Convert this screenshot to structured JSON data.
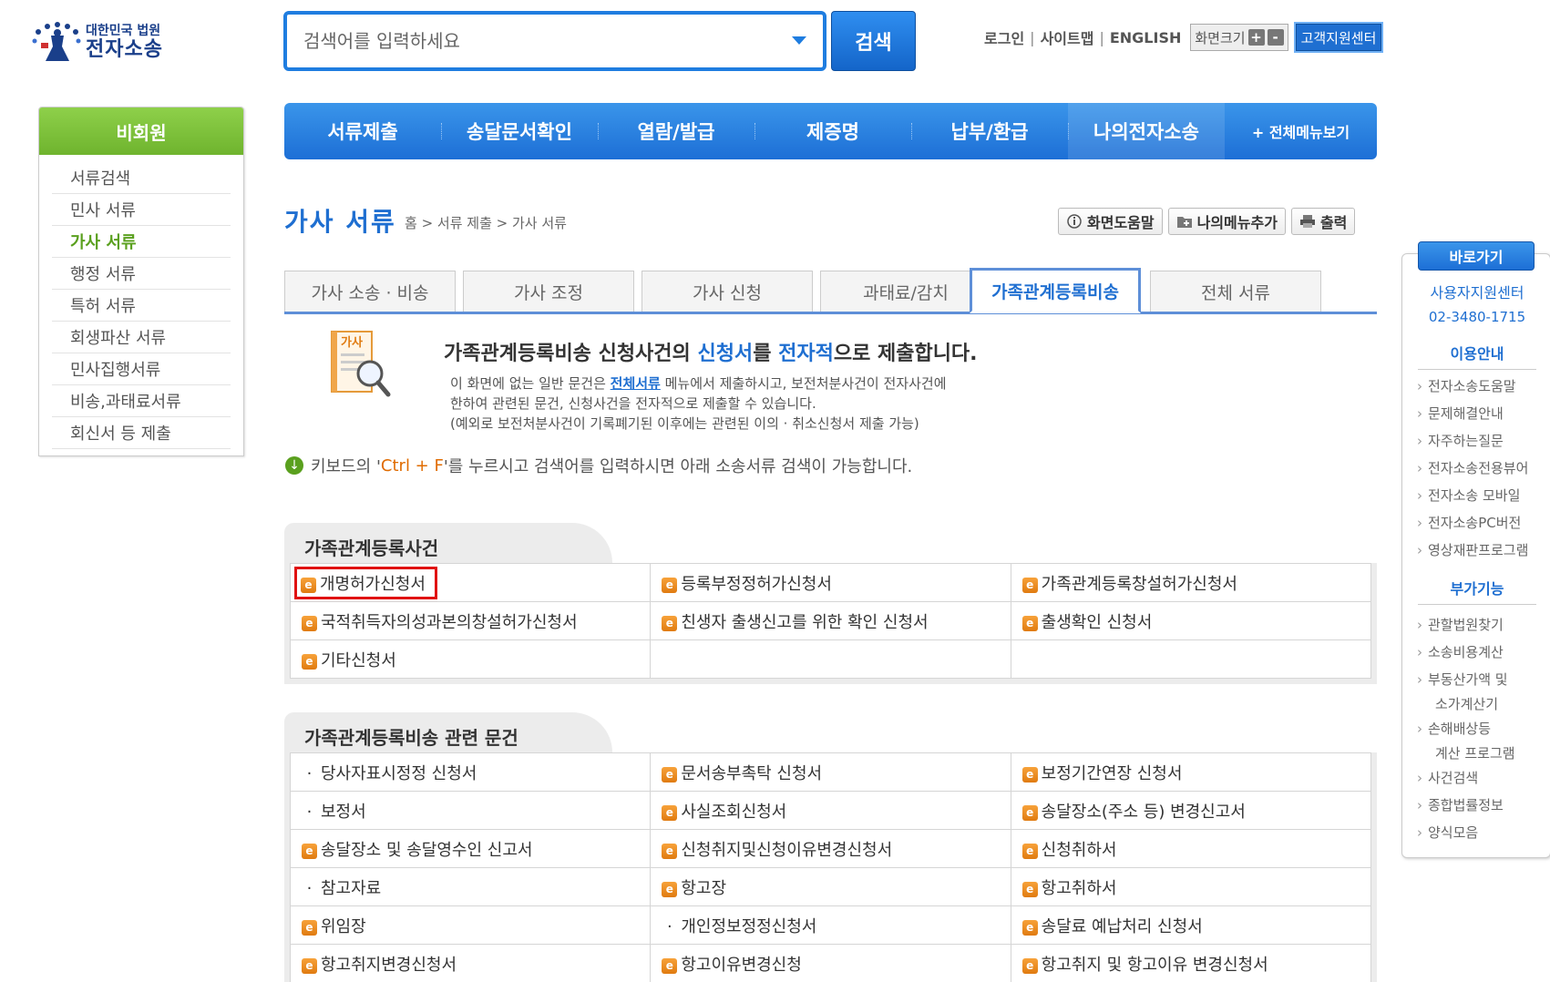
{
  "header": {
    "logo_sub": "대한민국 법원",
    "logo_main": "전자소송",
    "search_placeholder": "검색어를 입력하세요",
    "search_button": "검색",
    "util_links": [
      "로그인",
      "사이트맵",
      "ENGLISH"
    ],
    "font_size_label": "화면크기",
    "font_plus": "+",
    "font_minus": "-",
    "support_center": "고객지원센터"
  },
  "sidebar": {
    "title": "비회원",
    "items": [
      {
        "label": "서류검색",
        "active": false
      },
      {
        "label": "민사 서류",
        "active": false
      },
      {
        "label": "가사 서류",
        "active": true
      },
      {
        "label": "행정 서류",
        "active": false
      },
      {
        "label": "특허 서류",
        "active": false
      },
      {
        "label": "회생파산 서류",
        "active": false
      },
      {
        "label": "민사집행서류",
        "active": false
      },
      {
        "label": "비송,과태료서류",
        "active": false
      },
      {
        "label": "회신서 등 제출",
        "active": false
      }
    ]
  },
  "gnb": {
    "items": [
      "서류제출",
      "송달문서확인",
      "열람/발급",
      "제증명",
      "납부/환급",
      "나의전자소송"
    ],
    "all_menu": "+ 전체메뉴보기"
  },
  "page": {
    "title": "가사 서류",
    "breadcrumb": "홈 > 서류 제출 > 가사 서류",
    "tools": [
      "화면도움말",
      "나의메뉴추가",
      "출력"
    ]
  },
  "tabs": [
    "가사 소송 · 비송",
    "가사 조정",
    "가사 신청",
    "과태료/감치",
    "가족관계등록비송",
    "전체 서류"
  ],
  "active_tab_index": 4,
  "info": {
    "icon_label": "가사",
    "title_parts": [
      "가족관계등록비송 신청사건의 ",
      "신청서",
      "를 ",
      "전자적",
      "으로 제출합니다."
    ],
    "desc_line1_a": "이 화면에 없는 일반 문건은 ",
    "desc_line1_link": "전체서류",
    "desc_line1_b": " 메뉴에서 제출하시고, 보전처분사건이 전자사건에",
    "desc_line2": "한하여 관련된 문건, 신청사건을 전자적으로 제출할 수 있습니다.",
    "desc_line3": "(예외로 보전처분사건이 기록폐기된 이후에는 관련된 이의 · 취소신청서 제출 가능)"
  },
  "keyboard_tip": {
    "before": "키보드의 '",
    "key": "Ctrl + F",
    "after": "'를 누르시고 검색어를 입력하시면 아래 소송서류 검색이 가능합니다."
  },
  "section1": {
    "title": "가족관계등록사건",
    "rows": [
      [
        {
          "label": "개명허가신청서",
          "icon": "doc",
          "highlight": true
        },
        {
          "label": "등록부정정허가신청서",
          "icon": "doc"
        },
        {
          "label": "가족관계등록창설허가신청서",
          "icon": "doc"
        }
      ],
      [
        {
          "label": "국적취득자의성과본의창설허가신청서",
          "icon": "doc"
        },
        {
          "label": "친생자 출생신고를 위한 확인 신청서",
          "icon": "doc"
        },
        {
          "label": "출생확인 신청서",
          "icon": "doc"
        }
      ],
      [
        {
          "label": "기타신청서",
          "icon": "doc"
        },
        {
          "label": "",
          "icon": "none"
        },
        {
          "label": "",
          "icon": "none"
        }
      ]
    ]
  },
  "section2": {
    "title": "가족관계등록비송 관련 문건",
    "rows": [
      [
        {
          "label": "당사자표시정정 신청서",
          "icon": "bullet"
        },
        {
          "label": "문서송부촉탁 신청서",
          "icon": "doc"
        },
        {
          "label": "보정기간연장 신청서",
          "icon": "doc"
        }
      ],
      [
        {
          "label": "보정서",
          "icon": "bullet"
        },
        {
          "label": "사실조회신청서",
          "icon": "doc"
        },
        {
          "label": "송달장소(주소 등) 변경신고서",
          "icon": "doc"
        }
      ],
      [
        {
          "label": "송달장소 및 송달영수인 신고서",
          "icon": "doc"
        },
        {
          "label": "신청취지및신청이유변경신청서",
          "icon": "doc"
        },
        {
          "label": "신청취하서",
          "icon": "doc"
        }
      ],
      [
        {
          "label": "참고자료",
          "icon": "bullet"
        },
        {
          "label": "항고장",
          "icon": "doc"
        },
        {
          "label": "항고취하서",
          "icon": "doc"
        }
      ],
      [
        {
          "label": "위임장",
          "icon": "doc"
        },
        {
          "label": "개인정보정정신청서",
          "icon": "bullet"
        },
        {
          "label": "송달료 예납처리 신청서",
          "icon": "doc"
        }
      ],
      [
        {
          "label": "항고취지변경신청서",
          "icon": "doc"
        },
        {
          "label": "항고이유변경신청",
          "icon": "doc"
        },
        {
          "label": "항고취지 및 항고이유 변경신청서",
          "icon": "doc"
        }
      ]
    ]
  },
  "quick": {
    "title": "바로가기",
    "center_name": "사용자지원센터",
    "center_phone": "02-3480-1715",
    "guide_title": "이용안내",
    "guide_items": [
      "전자소송도움말",
      "문제해결안내",
      "자주하는질문",
      "전자소송전용뷰어",
      "전자소송 모바일",
      "전자소송PC버전",
      "영상재판프로그램"
    ],
    "extra_title": "부가기능",
    "extra_items": [
      {
        "label": "관할법원찾기"
      },
      {
        "label": "소송비용계산"
      },
      {
        "label": "부동산가액 및",
        "cont": "소가계산기"
      },
      {
        "label": "손해배상등",
        "cont": "계산 프로그램"
      },
      {
        "label": "사건검색"
      },
      {
        "label": "종합법률정보"
      },
      {
        "label": "양식모음"
      }
    ]
  },
  "colors": {
    "primary": "#1f6fd1",
    "green": "#6fb42e",
    "highlight_border": "#e01010",
    "doc_icon": "#e07b10"
  }
}
